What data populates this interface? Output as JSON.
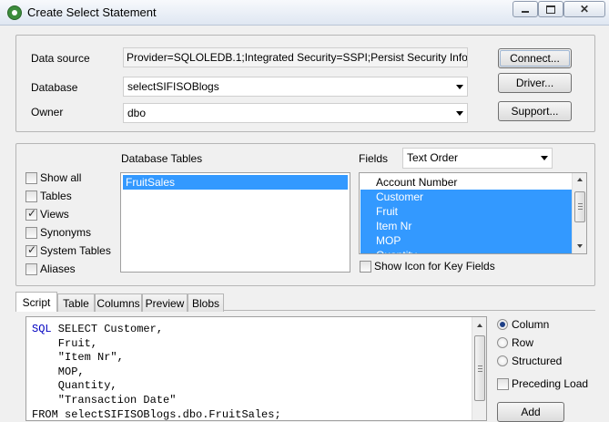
{
  "window": {
    "title": "Create Select Statement"
  },
  "connection": {
    "data_source_label": "Data source",
    "data_source_value": "Provider=SQLOLEDB.1;Integrated Security=SSPI;Persist Security Info",
    "database_label": "Database",
    "database_value": "selectSIFISOBlogs",
    "owner_label": "Owner",
    "owner_value": "dbo",
    "connect_button": "Connect...",
    "driver_button": "Driver...",
    "support_button": "Support..."
  },
  "filters": [
    {
      "label": "Show all",
      "checked": false
    },
    {
      "label": "Tables",
      "checked": false
    },
    {
      "label": "Views",
      "checked": true
    },
    {
      "label": "Synonyms",
      "checked": false
    },
    {
      "label": "System Tables",
      "checked": true
    },
    {
      "label": "Aliases",
      "checked": false
    }
  ],
  "tables": {
    "header": "Database Tables",
    "items": [
      {
        "label": "FruitSales",
        "selected": true
      }
    ]
  },
  "fields": {
    "label": "Fields",
    "order_value": "Text Order",
    "items": [
      {
        "label": "Account Number",
        "selected": false
      },
      {
        "label": "Customer",
        "selected": true
      },
      {
        "label": "Fruit",
        "selected": true
      },
      {
        "label": "Item Nr",
        "selected": true
      },
      {
        "label": "MOP",
        "selected": true
      },
      {
        "label": "Quantity",
        "selected": true
      }
    ],
    "show_icon_label": "Show Icon for Key Fields"
  },
  "tabs": [
    "Script",
    "Table",
    "Columns",
    "Preview",
    "Blobs"
  ],
  "script": {
    "keyword": "SQL",
    "body": " SELECT Customer,\n    Fruit,\n    \"Item Nr\",\n    MOP,\n    Quantity,\n    \"Transaction Date\"\nFROM selectSIFISOBlogs.dbo.FruitSales;"
  },
  "options": {
    "column_label": "Column",
    "row_label": "Row",
    "structured_label": "Structured",
    "selected": "Column",
    "preceding_load_label": "Preceding Load",
    "add_button": "Add"
  }
}
